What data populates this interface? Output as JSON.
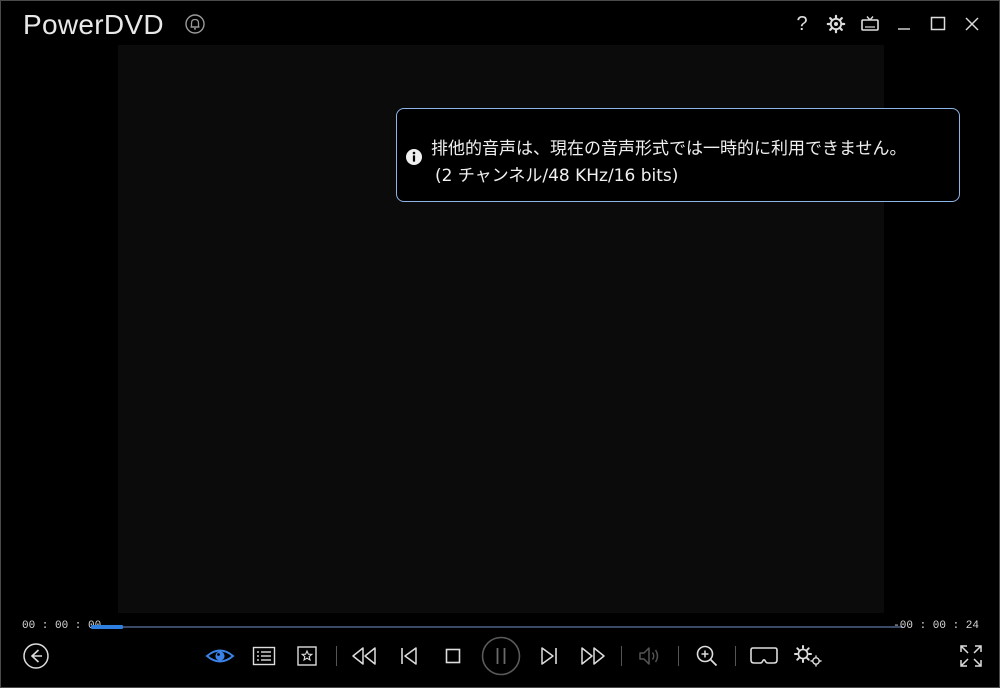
{
  "app": {
    "title": "PowerDVD"
  },
  "osd": {
    "line1": "排他的音声は、現在の音声形式では一時的に利用できません。",
    "line2": "(2 チャンネル/48 KHz/16 bits)"
  },
  "top_controls": {
    "help_label": "?"
  },
  "playback": {
    "elapsed": "00 : 00 : 00",
    "remaining": "-00 : 00 : 24",
    "progress_fraction": 0.04
  },
  "colors": {
    "accent": "#2f7fe0",
    "osd_border": "#8fb4e8",
    "video_bg": "#0b0b0b"
  }
}
